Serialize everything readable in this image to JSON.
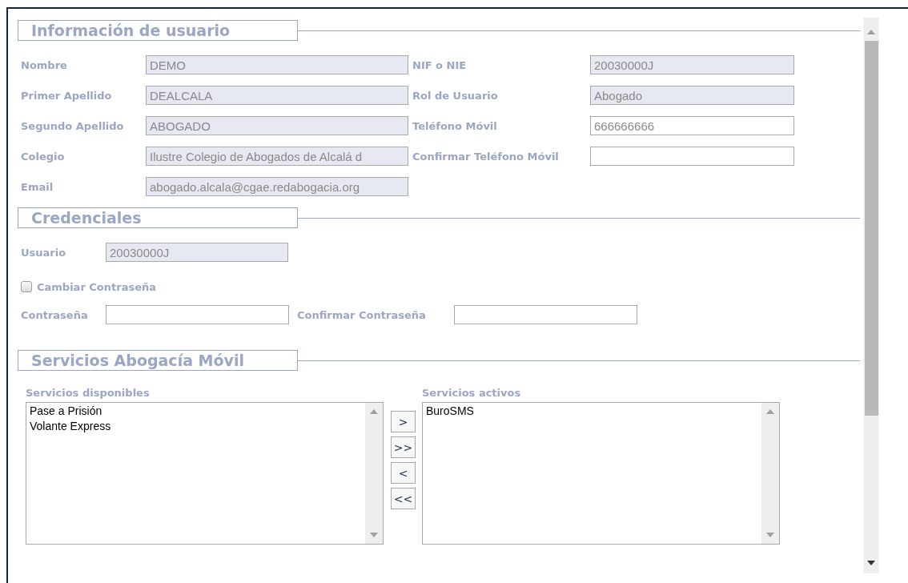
{
  "user_info": {
    "title": "Información de usuario",
    "left_fields": [
      {
        "label": "Nombre",
        "value": "DEMO",
        "disabled": true
      },
      {
        "label": "Primer Apellido",
        "value": "DEALCALA",
        "disabled": true
      },
      {
        "label": "Segundo Apellido",
        "value": "ABOGADO",
        "disabled": true
      },
      {
        "label": "Colegio",
        "value": "Ilustre Colegio de Abogados de Alcalá d",
        "disabled": true
      },
      {
        "label": "Email",
        "value": "abogado.alcala@cgae.redabogacia.org",
        "disabled": true
      }
    ],
    "right_fields": [
      {
        "label": "NIF o NIE",
        "value": "20030000J",
        "disabled": true
      },
      {
        "label": "Rol de Usuario",
        "value": "Abogado",
        "disabled": true
      },
      {
        "label": "Teléfono Móvil",
        "value": "666666666",
        "disabled": false
      },
      {
        "label": "Confirmar Teléfono Móvil",
        "disabled": false
      }
    ]
  },
  "credentials": {
    "title": "Credenciales",
    "user": {
      "label": "Usuario",
      "value": "20030000J",
      "disabled": true
    },
    "change_password": {
      "label": "Cambiar Contraseña",
      "checked": false
    },
    "password": {
      "label": "Contraseña",
      "disabled": false
    },
    "confirm_password": {
      "label": "Confirmar Contraseña",
      "disabled": false
    }
  },
  "mobile_services": {
    "title": "Servicios Abogacía Móvil",
    "available": {
      "label": "Servicios disponibles",
      "items": [
        "Pase a Prisión",
        "Volante Express"
      ]
    },
    "buttons": [
      ">",
      ">>",
      "<",
      "<<"
    ],
    "active": {
      "label": "Servicios activos",
      "items": [
        "BuroSMS"
      ]
    }
  }
}
